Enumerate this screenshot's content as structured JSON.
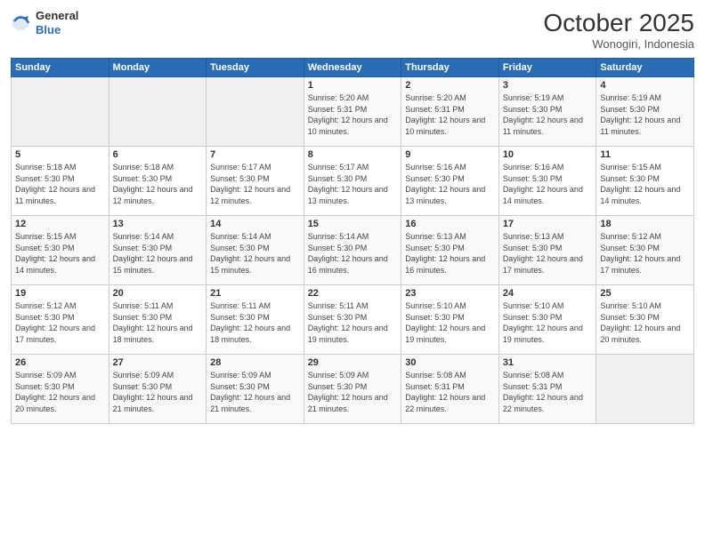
{
  "header": {
    "logo_line1": "General",
    "logo_line2": "Blue",
    "month": "October 2025",
    "location": "Wonogiri, Indonesia"
  },
  "weekdays": [
    "Sunday",
    "Monday",
    "Tuesday",
    "Wednesday",
    "Thursday",
    "Friday",
    "Saturday"
  ],
  "weeks": [
    [
      {
        "day": "",
        "info": ""
      },
      {
        "day": "",
        "info": ""
      },
      {
        "day": "",
        "info": ""
      },
      {
        "day": "1",
        "info": "Sunrise: 5:20 AM\nSunset: 5:31 PM\nDaylight: 12 hours and 10 minutes."
      },
      {
        "day": "2",
        "info": "Sunrise: 5:20 AM\nSunset: 5:31 PM\nDaylight: 12 hours and 10 minutes."
      },
      {
        "day": "3",
        "info": "Sunrise: 5:19 AM\nSunset: 5:30 PM\nDaylight: 12 hours and 11 minutes."
      },
      {
        "day": "4",
        "info": "Sunrise: 5:19 AM\nSunset: 5:30 PM\nDaylight: 12 hours and 11 minutes."
      }
    ],
    [
      {
        "day": "5",
        "info": "Sunrise: 5:18 AM\nSunset: 5:30 PM\nDaylight: 12 hours and 11 minutes."
      },
      {
        "day": "6",
        "info": "Sunrise: 5:18 AM\nSunset: 5:30 PM\nDaylight: 12 hours and 12 minutes."
      },
      {
        "day": "7",
        "info": "Sunrise: 5:17 AM\nSunset: 5:30 PM\nDaylight: 12 hours and 12 minutes."
      },
      {
        "day": "8",
        "info": "Sunrise: 5:17 AM\nSunset: 5:30 PM\nDaylight: 12 hours and 13 minutes."
      },
      {
        "day": "9",
        "info": "Sunrise: 5:16 AM\nSunset: 5:30 PM\nDaylight: 12 hours and 13 minutes."
      },
      {
        "day": "10",
        "info": "Sunrise: 5:16 AM\nSunset: 5:30 PM\nDaylight: 12 hours and 14 minutes."
      },
      {
        "day": "11",
        "info": "Sunrise: 5:15 AM\nSunset: 5:30 PM\nDaylight: 12 hours and 14 minutes."
      }
    ],
    [
      {
        "day": "12",
        "info": "Sunrise: 5:15 AM\nSunset: 5:30 PM\nDaylight: 12 hours and 14 minutes."
      },
      {
        "day": "13",
        "info": "Sunrise: 5:14 AM\nSunset: 5:30 PM\nDaylight: 12 hours and 15 minutes."
      },
      {
        "day": "14",
        "info": "Sunrise: 5:14 AM\nSunset: 5:30 PM\nDaylight: 12 hours and 15 minutes."
      },
      {
        "day": "15",
        "info": "Sunrise: 5:14 AM\nSunset: 5:30 PM\nDaylight: 12 hours and 16 minutes."
      },
      {
        "day": "16",
        "info": "Sunrise: 5:13 AM\nSunset: 5:30 PM\nDaylight: 12 hours and 16 minutes."
      },
      {
        "day": "17",
        "info": "Sunrise: 5:13 AM\nSunset: 5:30 PM\nDaylight: 12 hours and 17 minutes."
      },
      {
        "day": "18",
        "info": "Sunrise: 5:12 AM\nSunset: 5:30 PM\nDaylight: 12 hours and 17 minutes."
      }
    ],
    [
      {
        "day": "19",
        "info": "Sunrise: 5:12 AM\nSunset: 5:30 PM\nDaylight: 12 hours and 17 minutes."
      },
      {
        "day": "20",
        "info": "Sunrise: 5:11 AM\nSunset: 5:30 PM\nDaylight: 12 hours and 18 minutes."
      },
      {
        "day": "21",
        "info": "Sunrise: 5:11 AM\nSunset: 5:30 PM\nDaylight: 12 hours and 18 minutes."
      },
      {
        "day": "22",
        "info": "Sunrise: 5:11 AM\nSunset: 5:30 PM\nDaylight: 12 hours and 19 minutes."
      },
      {
        "day": "23",
        "info": "Sunrise: 5:10 AM\nSunset: 5:30 PM\nDaylight: 12 hours and 19 minutes."
      },
      {
        "day": "24",
        "info": "Sunrise: 5:10 AM\nSunset: 5:30 PM\nDaylight: 12 hours and 19 minutes."
      },
      {
        "day": "25",
        "info": "Sunrise: 5:10 AM\nSunset: 5:30 PM\nDaylight: 12 hours and 20 minutes."
      }
    ],
    [
      {
        "day": "26",
        "info": "Sunrise: 5:09 AM\nSunset: 5:30 PM\nDaylight: 12 hours and 20 minutes."
      },
      {
        "day": "27",
        "info": "Sunrise: 5:09 AM\nSunset: 5:30 PM\nDaylight: 12 hours and 21 minutes."
      },
      {
        "day": "28",
        "info": "Sunrise: 5:09 AM\nSunset: 5:30 PM\nDaylight: 12 hours and 21 minutes."
      },
      {
        "day": "29",
        "info": "Sunrise: 5:09 AM\nSunset: 5:30 PM\nDaylight: 12 hours and 21 minutes."
      },
      {
        "day": "30",
        "info": "Sunrise: 5:08 AM\nSunset: 5:31 PM\nDaylight: 12 hours and 22 minutes."
      },
      {
        "day": "31",
        "info": "Sunrise: 5:08 AM\nSunset: 5:31 PM\nDaylight: 12 hours and 22 minutes."
      },
      {
        "day": "",
        "info": ""
      }
    ]
  ]
}
